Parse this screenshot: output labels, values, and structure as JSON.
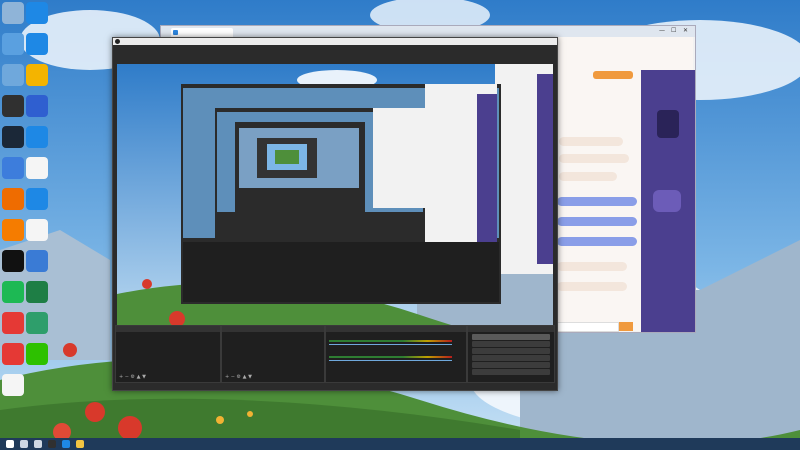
{
  "colors": {
    "sky_top": "#2f7cc9",
    "sky_mid": "#7cb6e6",
    "cloud": "#e9f2fb",
    "mountain": "#9fb6cc",
    "grass": "#4e8f3a",
    "flower": "#d8392b",
    "obs_bg": "#2b2b2b",
    "obs_panel": "#1f1f1f",
    "browser_bg": "#f2f2f2",
    "chat_purple": "#4b3f8f",
    "chat_orange": "#f09a3e",
    "taskbar": "#1f3a5a"
  },
  "desktop": {
    "icons": [
      {
        "name": "recycle-bin-icon",
        "color": "#8fb4d8"
      },
      {
        "name": "edge-icon",
        "color": "#1e88e5"
      },
      {
        "name": "computer-icon",
        "color": "#5aa0e0"
      },
      {
        "name": "edge-icon",
        "color": "#1e88e5"
      },
      {
        "name": "control-panel-icon",
        "color": "#6fa8dc"
      },
      {
        "name": "owl-app-icon",
        "color": "#f4b400"
      },
      {
        "name": "obs-icon",
        "color": "#303030"
      },
      {
        "name": "paw-app-icon",
        "color": "#2f5fd0"
      },
      {
        "name": "steam-icon",
        "color": "#1b2838"
      },
      {
        "name": "edge-icon",
        "color": "#1e88e5"
      },
      {
        "name": "app-tile-icon",
        "color": "#3d7ddc"
      },
      {
        "name": "document-icon",
        "color": "#f5f5f5"
      },
      {
        "name": "fox-app-icon",
        "color": "#ef6c00"
      },
      {
        "name": "edge-icon",
        "color": "#1e88e5"
      },
      {
        "name": "orange-app-icon",
        "color": "#f57c00"
      },
      {
        "name": "document-icon",
        "color": "#f5f5f5"
      },
      {
        "name": "qq-icon",
        "color": "#111111"
      },
      {
        "name": "gear-app-icon",
        "color": "#3a7bd5"
      },
      {
        "name": "green-app-icon",
        "color": "#1db954"
      },
      {
        "name": "excel-icon",
        "color": "#1e7e45"
      },
      {
        "name": "netease-music-icon",
        "color": "#e53935"
      },
      {
        "name": "green-tool-icon",
        "color": "#2e9e6b"
      },
      {
        "name": "netease-music-icon",
        "color": "#e53935"
      },
      {
        "name": "wechat-icon",
        "color": "#2dc100"
      },
      {
        "name": "document-icon",
        "color": "#f5f5f5"
      }
    ]
  },
  "browser": {
    "tab_title": "",
    "controls": {
      "minimize": "—",
      "maximize": "☐",
      "close": "✕"
    }
  },
  "obs": {
    "title": "",
    "menu": [
      "",
      "",
      "",
      "",
      "",
      ""
    ],
    "docks": {
      "scenes": {
        "header": "",
        "items": [
          ""
        ]
      },
      "sources": {
        "header": "",
        "items": [
          "",
          "",
          ""
        ]
      },
      "mixer": {
        "header": "",
        "tracks": [
          "",
          ""
        ]
      },
      "transitions": {
        "header": ""
      },
      "controls": {
        "header": "",
        "buttons": [
          "",
          "",
          "",
          "",
          "",
          ""
        ]
      }
    },
    "status": ""
  },
  "taskbar": {
    "apps": [
      {
        "name": "start-icon",
        "color": "#ffffff"
      },
      {
        "name": "search-icon",
        "color": "#cfd8e3"
      },
      {
        "name": "taskview-icon",
        "color": "#cfd8e3"
      },
      {
        "name": "obs-icon",
        "color": "#303030"
      },
      {
        "name": "edge-icon",
        "color": "#1e88e5"
      },
      {
        "name": "folder-icon",
        "color": "#f4c542"
      }
    ],
    "clock_time": "",
    "clock_date": ""
  }
}
